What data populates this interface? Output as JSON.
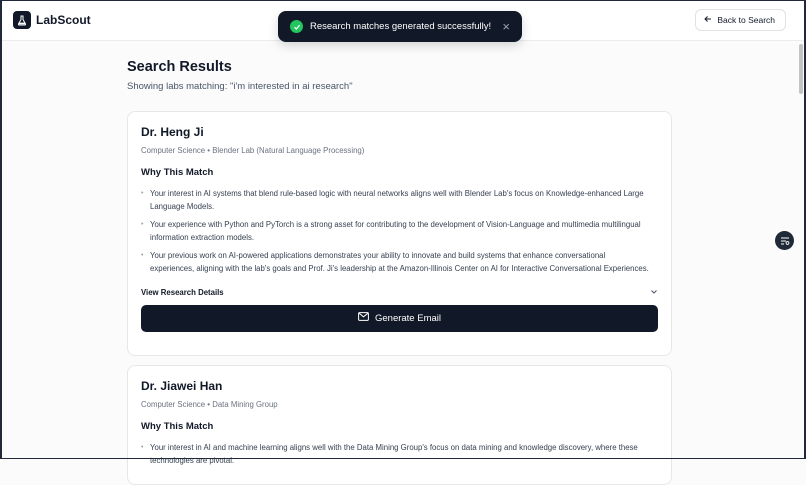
{
  "app": {
    "name": "LabScout",
    "back_label": "Back to Search"
  },
  "toast": {
    "message": "Research matches generated successfully!",
    "close_glyph": "×"
  },
  "page": {
    "title": "Search Results",
    "subtitle": "Showing labs matching: \"i'm interested in ai research\""
  },
  "results": [
    {
      "name": "Dr. Heng Ji",
      "department": "Computer Science • Blender Lab (Natural Language Processing)",
      "why_heading": "Why This Match",
      "reasons": [
        "Your interest in AI systems that blend rule-based logic with neural networks aligns well with Blender Lab's focus on Knowledge-enhanced Large Language Models.",
        "Your experience with Python and PyTorch is a strong asset for contributing to the development of Vision-Language and multimedia multilingual information extraction models.",
        "Your previous work on AI-powered applications demonstrates your ability to innovate and build systems that enhance conversational experiences, aligning with the lab's goals and Prof. Ji's leadership at the Amazon-Illinois Center on AI for Interactive Conversational Experiences."
      ],
      "details_label": "View Research Details",
      "email_label": "Generate Email"
    },
    {
      "name": "Dr. Jiawei Han",
      "department": "Computer Science • Data Mining Group",
      "why_heading": "Why This Match",
      "reasons": [
        "Your interest in AI and machine learning aligns well with the Data Mining Group's focus on data mining and knowledge discovery, where these technologies are pivotal."
      ]
    }
  ],
  "icons": {
    "logo": "flask-icon",
    "back": "arrow-left-icon",
    "toast_status": "check-circle-icon",
    "details": "chevron-down-icon",
    "email": "mail-icon",
    "side": "list-filter-icon"
  },
  "colors": {
    "primary": "#111827",
    "success": "#22c55e",
    "muted": "#6b7280",
    "background": "#fbfbfb"
  }
}
